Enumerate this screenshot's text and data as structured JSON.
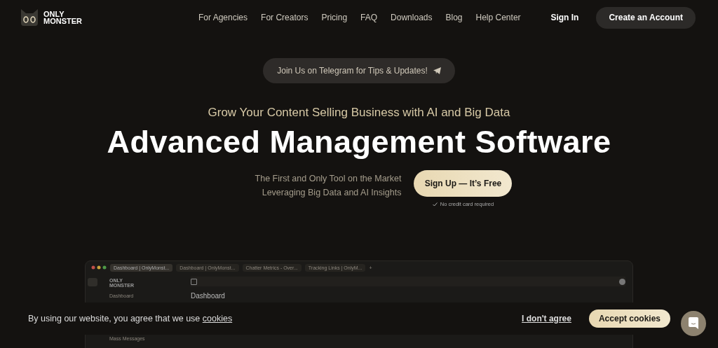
{
  "logo": {
    "line_1": "ONLY",
    "line_2": "MONSTER"
  },
  "nav": {
    "links": [
      "For Agencies",
      "For Creators",
      "Pricing",
      "FAQ",
      "Downloads",
      "Blog",
      "Help Center"
    ],
    "sign_in": "Sign In",
    "create_account": "Create an Account"
  },
  "announcement": {
    "label": "Join Us on Telegram for Tips & Updates!"
  },
  "hero": {
    "subtitle": "Grow Your Content Selling Business with AI and Big Data",
    "title": "Advanced Management Software",
    "tagline_lines": [
      "The First and Only Tool on the Market",
      "Leveraging Big Data and AI Insights"
    ],
    "cta": "Sign Up — It’s Free",
    "note": "No credit card required"
  },
  "preview": {
    "tabs": [
      {
        "label": "Dashboard | OnlyMonst...",
        "selected": true
      },
      {
        "label": "Dashboard | OnlyMonst...",
        "selected": false
      },
      {
        "label": "Chatter Metrics - Over...",
        "selected": false
      },
      {
        "label": "Tracking Links | OnlyM...",
        "selected": false
      }
    ],
    "tab_add": "+",
    "logo": {
      "line_1": "ONLY",
      "line_2": "MONSTER"
    },
    "sidebar_items": [
      "Dashboard",
      "Mass Messages"
    ],
    "heading": "Dashboard"
  },
  "cookie_banner": {
    "text_before": "By using our website, you agree that we use",
    "link": "cookies",
    "decline": "I don't agree",
    "accept": "Accept cookies"
  }
}
